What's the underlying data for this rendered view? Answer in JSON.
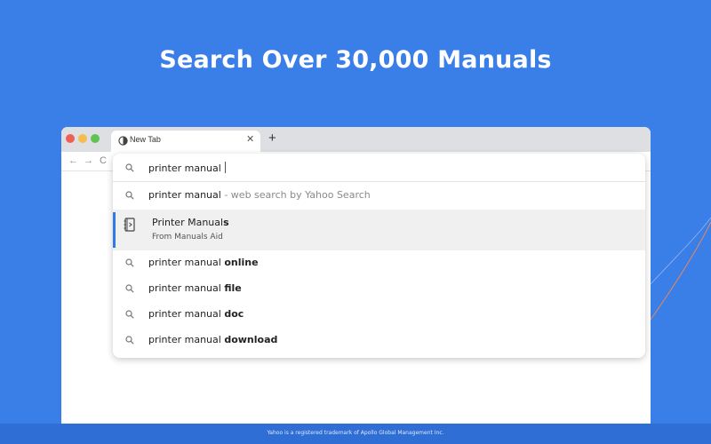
{
  "headline": "Search Over 30,000 Manuals",
  "browser": {
    "tab": {
      "title": "New Tab",
      "favicon": "globe-icon",
      "close": "✕"
    },
    "new_tab": "+",
    "nav": {
      "back": "←",
      "forward": "→",
      "reload": "C"
    }
  },
  "omnibox": {
    "query": "printer manual",
    "web_search": {
      "text": "printer manual",
      "suffix": " - web search by Yahoo Search"
    },
    "featured": {
      "title_prefix": "Printer Manual",
      "title_bold": "s",
      "subtitle": "From Manuals Aid",
      "icon": "manual-book-icon"
    },
    "suggestions": [
      {
        "prefix": "printer manual ",
        "bold": "online"
      },
      {
        "prefix": "printer manual ",
        "bold": "file"
      },
      {
        "prefix": "printer manual ",
        "bold": "doc"
      },
      {
        "prefix": "printer manual ",
        "bold": "download"
      }
    ]
  },
  "footer": "Yahoo is a registered trademark of Apollo Global Management Inc.",
  "colors": {
    "background": "#3a7ee8",
    "footer": "#2f6ed4",
    "accent": "#2f7be5",
    "highlight_row": "#f0f0f0"
  }
}
